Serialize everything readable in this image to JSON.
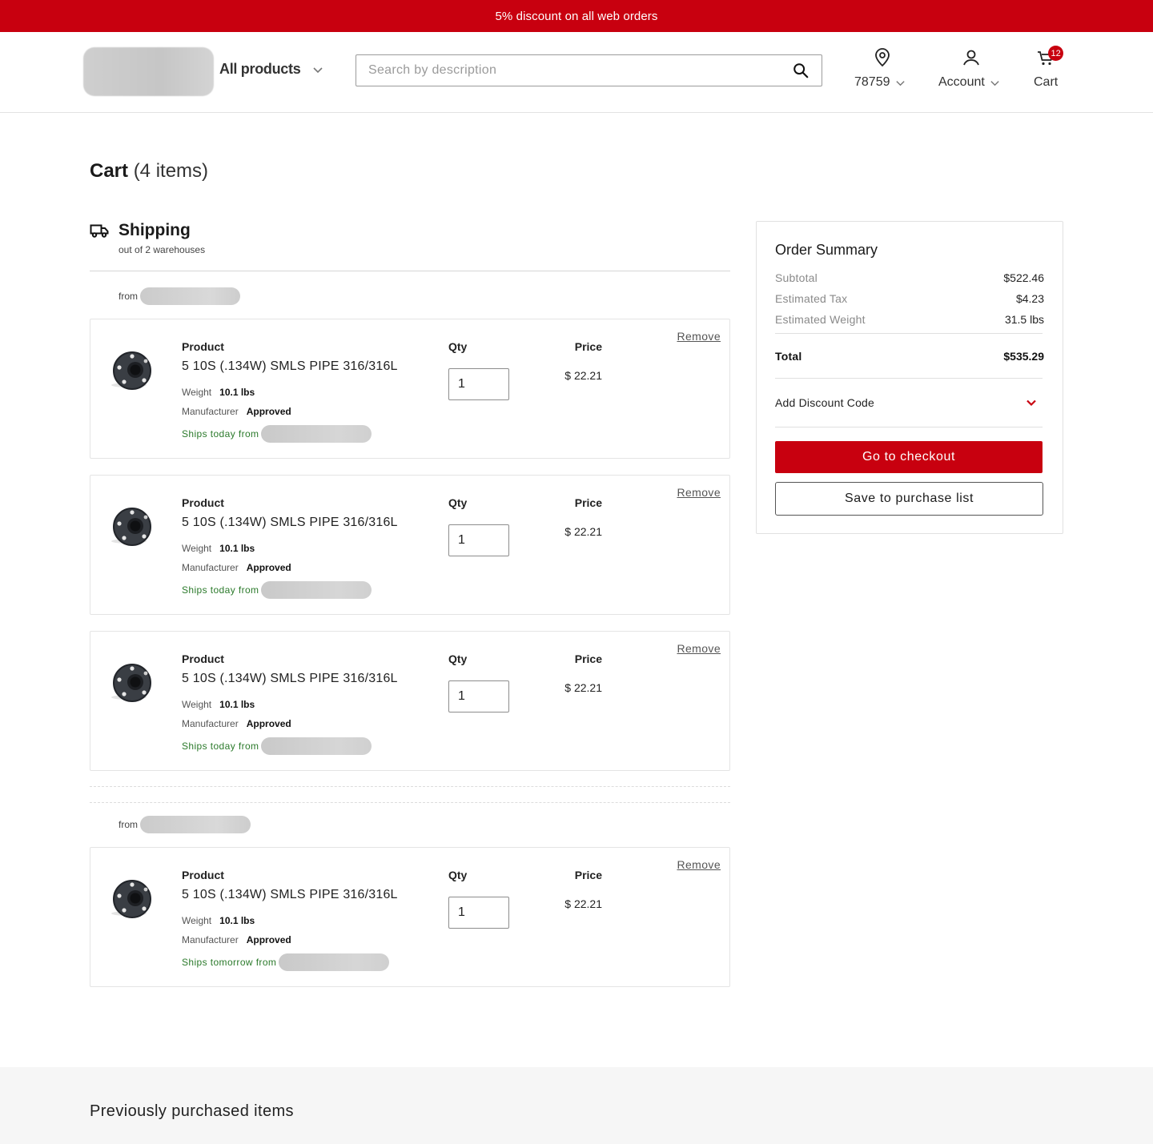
{
  "promo": {
    "text": "5% discount on all web orders"
  },
  "header": {
    "all_products_label": "All products",
    "search_placeholder": "Search by description",
    "location_label": "78759",
    "account_label": "Account",
    "cart_label": "Cart",
    "cart_badge": "12"
  },
  "cart": {
    "title": "Cart",
    "count_text": "(4 items)"
  },
  "shipping": {
    "title": "Shipping",
    "subtitle": "out of 2 warehouses"
  },
  "labels": {
    "from": "from",
    "product": "Product",
    "qty": "Qty",
    "price": "Price",
    "remove": "Remove",
    "weight": "Weight",
    "manufacturer": "Manufacturer"
  },
  "items": [
    {
      "name": "5 10S (.134W) SMLS PIPE 316/316L",
      "weight": "10.1 lbs",
      "manufacturer": "Approved",
      "ships": "Ships today from",
      "qty": "1",
      "price": "$ 22.21"
    },
    {
      "name": "5 10S (.134W) SMLS PIPE 316/316L",
      "weight": "10.1 lbs",
      "manufacturer": "Approved",
      "ships": "Ships today from",
      "qty": "1",
      "price": "$ 22.21"
    },
    {
      "name": "5 10S (.134W) SMLS PIPE 316/316L",
      "weight": "10.1 lbs",
      "manufacturer": "Approved",
      "ships": "Ships today from",
      "qty": "1",
      "price": "$ 22.21"
    },
    {
      "name": "5 10S (.134W) SMLS PIPE 316/316L",
      "weight": "10.1 lbs",
      "manufacturer": "Approved",
      "ships": "Ships tomorrow from",
      "qty": "1",
      "price": "$ 22.21"
    }
  ],
  "summary": {
    "title": "Order Summary",
    "subtotal_label": "Subtotal",
    "subtotal": "$522.46",
    "tax_label": "Estimated Tax",
    "tax": "$4.23",
    "weight_label": "Estimated Weight",
    "weight": "31.5 lbs",
    "total_label": "Total",
    "total": "$535.29",
    "discount_label": "Add Discount Code",
    "checkout_label": "Go to checkout",
    "save_label": "Save to purchase list"
  },
  "previous": {
    "title": "Previously purchased items"
  },
  "colors": {
    "brand_red": "#c8000f",
    "in_stock_green": "#2b7a2b"
  },
  "icons": [
    "search-icon",
    "location-pin-icon",
    "user-icon",
    "cart-icon",
    "truck-icon",
    "chevron-down-icon",
    "pipe-flange-icon"
  ]
}
